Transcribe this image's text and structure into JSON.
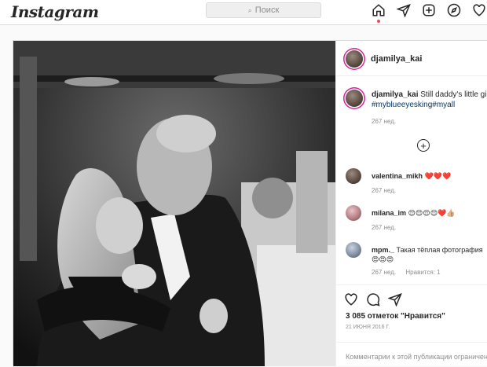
{
  "app": {
    "logo": "Instagram"
  },
  "search": {
    "placeholder": "Поиск",
    "icon": "search-icon"
  },
  "nav": {
    "icons": [
      "home-icon",
      "direct-icon",
      "new-post-icon",
      "explore-icon",
      "heart-icon"
    ],
    "active_dot_color": "#ed4956"
  },
  "post": {
    "author": "djamilya_kai",
    "photo_description_icon": "photo",
    "caption": {
      "user": "djamilya_kai",
      "text": "Still daddy's little girl",
      "tags": "#myblueeyesking#myall",
      "time": "267 нед."
    },
    "load_more_icon": "plus-circle-icon",
    "comments": [
      {
        "user": "valentina_mikh",
        "text": "❤️❤️❤️",
        "time": "267 нед.",
        "like_label": ""
      },
      {
        "user": "milana_im",
        "text": "😌😌😌😌❤️👍🏼",
        "time": "267 нед.",
        "like_label": ""
      },
      {
        "user": "mpm._",
        "text": "Такая тёплая фотография",
        "text2": "😍😍😍",
        "time": "267 нед.",
        "like_label": "Нравится: 1"
      }
    ],
    "likes": "3 085 отметок \"Нравится\"",
    "date": "21 ИЮНЯ 2016 Г.",
    "comments_disabled": "Комментарии к этой публикации ограничены"
  }
}
